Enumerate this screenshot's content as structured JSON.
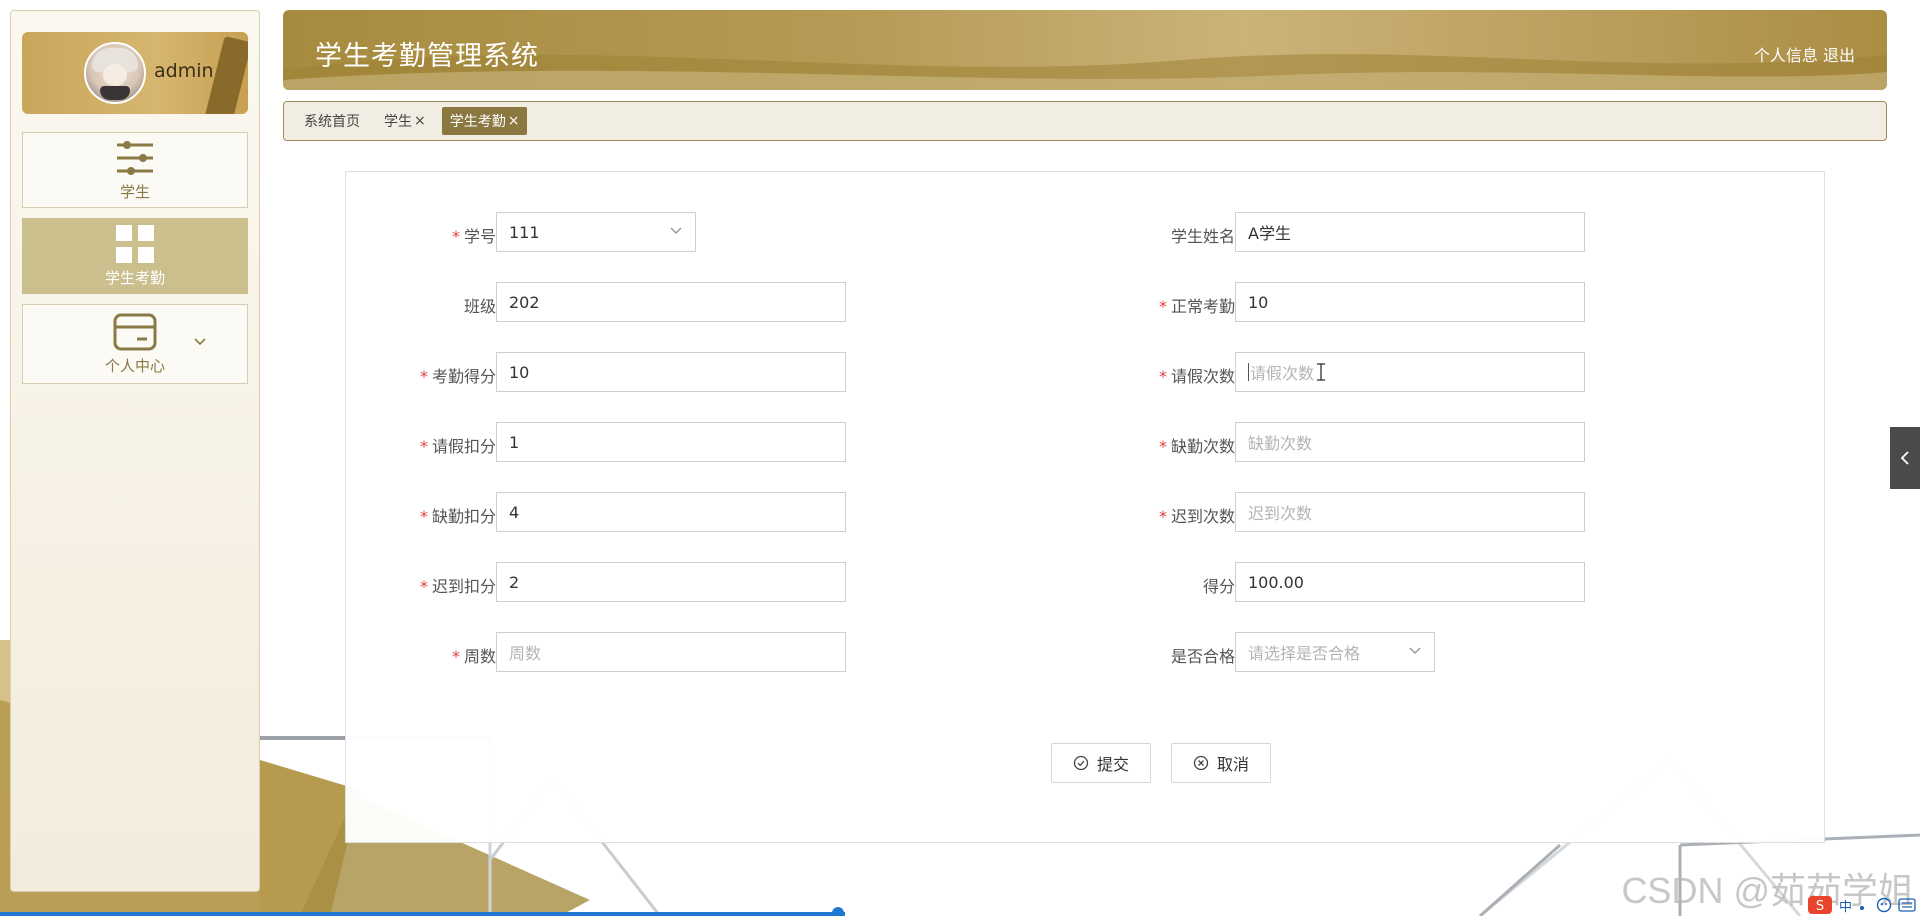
{
  "app": {
    "title": "学生考勤管理系统",
    "user_name": "admin",
    "header_links": {
      "profile": "个人信息",
      "logout": "退出"
    }
  },
  "sidebar": {
    "items": [
      {
        "label": "学生",
        "icon": "sliders-icon"
      },
      {
        "label": "学生考勤",
        "icon": "grid-icon",
        "active": true
      },
      {
        "label": "个人中心",
        "icon": "card-icon"
      }
    ]
  },
  "tabs": [
    {
      "label": "系统首页"
    },
    {
      "label": "学生",
      "close": "×"
    },
    {
      "label": "学生考勤",
      "close": "×",
      "active": true
    }
  ],
  "form": {
    "fields": {
      "student_no": {
        "label": "学号",
        "required": "*",
        "value": "111"
      },
      "student_name": {
        "label": "学生姓名",
        "value": "A学生"
      },
      "class": {
        "label": "班级",
        "value": "202"
      },
      "normal_attendance": {
        "label": "正常考勤",
        "required": "*",
        "value": "10"
      },
      "attendance_score": {
        "label": "考勤得分",
        "required": "*",
        "value": "10"
      },
      "leave_count": {
        "label": "请假次数",
        "required": "*",
        "placeholder": "请假次数"
      },
      "leave_deduction": {
        "label": "请假扣分",
        "required": "*",
        "value": "1"
      },
      "absence_count": {
        "label": "缺勤次数",
        "required": "*",
        "placeholder": "缺勤次数"
      },
      "absence_deduction": {
        "label": "缺勤扣分",
        "required": "*",
        "value": "4"
      },
      "late_count": {
        "label": "迟到次数",
        "required": "*",
        "placeholder": "迟到次数"
      },
      "late_deduction": {
        "label": "迟到扣分",
        "required": "*",
        "value": "2"
      },
      "score": {
        "label": "得分",
        "value": "100.00"
      },
      "week": {
        "label": "周数",
        "required": "*",
        "placeholder": "周数"
      },
      "qualified": {
        "label": "是否合格",
        "placeholder": "请选择是否合格"
      }
    },
    "buttons": {
      "submit": "提交",
      "cancel": "取消"
    }
  },
  "watermark": "CSDN @茹茹学姐",
  "tray": {
    "ime": "中"
  },
  "colors": {
    "accent": "#8b7740",
    "header": "#b59a55",
    "active_menu": "#cbbf8e",
    "required": "#e04040"
  }
}
